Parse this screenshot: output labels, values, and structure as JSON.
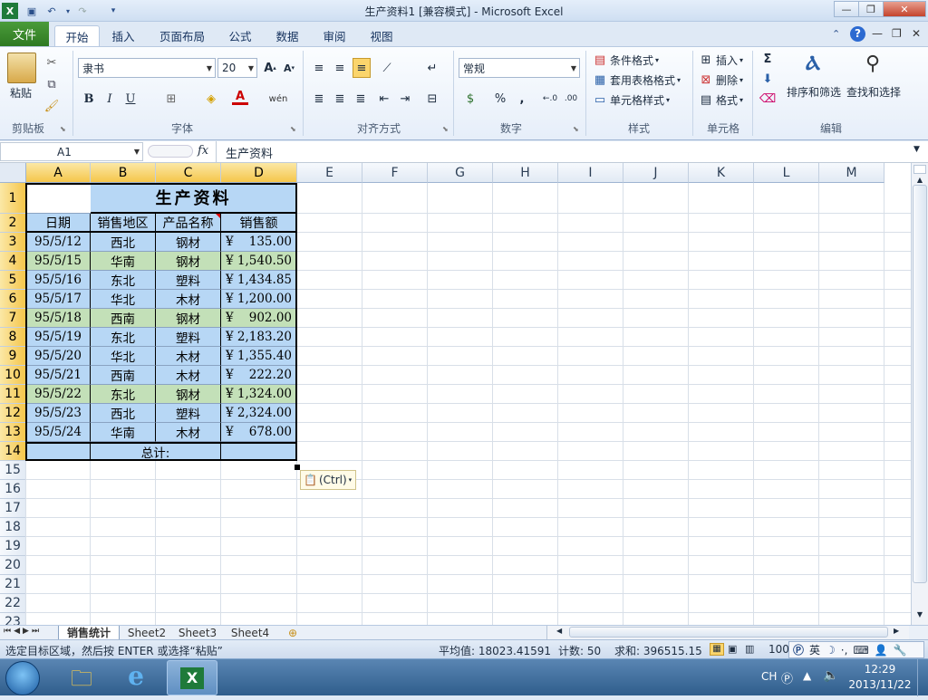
{
  "window": {
    "title": "生产资料1  [兼容模式]  -  Microsoft Excel"
  },
  "tabs": {
    "file": "文件",
    "items": [
      "开始",
      "插入",
      "页面布局",
      "公式",
      "数据",
      "审阅",
      "视图"
    ]
  },
  "ribbon": {
    "clipboard": {
      "paste": "粘贴",
      "label": "剪贴板"
    },
    "font": {
      "name": "隶书",
      "size": "20",
      "bold": "B",
      "italic": "I",
      "underline": "U",
      "label": "字体"
    },
    "alignment": {
      "label": "对齐方式"
    },
    "number": {
      "format": "常规",
      "percent": "%",
      "comma": ",",
      "label": "数字"
    },
    "styles": {
      "conditional": "条件格式",
      "table": "套用表格格式",
      "cell": "单元格样式",
      "label": "样式"
    },
    "cells": {
      "insert": "插入",
      "delete": "删除",
      "format": "格式",
      "label": "单元格"
    },
    "editing": {
      "sigma": "Σ",
      "sort": "排序和筛选",
      "find": "查找和选择",
      "label": "编辑"
    }
  },
  "formula_bar": {
    "name_box": "A1",
    "fx": "fx",
    "content": "生产资料"
  },
  "columns": [
    "A",
    "B",
    "C",
    "D",
    "E",
    "F",
    "G",
    "H",
    "I",
    "J",
    "K",
    "L",
    "M"
  ],
  "rows": [
    "1",
    "2",
    "3",
    "4",
    "5",
    "6",
    "7",
    "8",
    "9",
    "10",
    "11",
    "12",
    "13",
    "14",
    "15",
    "16",
    "17",
    "18",
    "19",
    "20",
    "21",
    "22",
    "23"
  ],
  "table": {
    "title": "生产资料",
    "headers": [
      "日期",
      "销售地区",
      "产品名称",
      "销售额"
    ],
    "rows": [
      {
        "date": "95/5/12",
        "region": "西北",
        "product": "钢材",
        "amount": "¥    135.00",
        "green": false
      },
      {
        "date": "95/5/15",
        "region": "华南",
        "product": "钢材",
        "amount": "¥ 1,540.50",
        "green": true
      },
      {
        "date": "95/5/16",
        "region": "东北",
        "product": "塑料",
        "amount": "¥ 1,434.85",
        "green": false
      },
      {
        "date": "95/5/17",
        "region": "华北",
        "product": "木材",
        "amount": "¥ 1,200.00",
        "green": false
      },
      {
        "date": "95/5/18",
        "region": "西南",
        "product": "钢材",
        "amount": "¥    902.00",
        "green": true
      },
      {
        "date": "95/5/19",
        "region": "东北",
        "product": "塑料",
        "amount": "¥ 2,183.20",
        "green": false
      },
      {
        "date": "95/5/20",
        "region": "华北",
        "product": "木材",
        "amount": "¥ 1,355.40",
        "green": false
      },
      {
        "date": "95/5/21",
        "region": "西南",
        "product": "木材",
        "amount": "¥    222.20",
        "green": false
      },
      {
        "date": "95/5/22",
        "region": "东北",
        "product": "钢材",
        "amount": "¥ 1,324.00",
        "green": true
      },
      {
        "date": "95/5/23",
        "region": "西北",
        "product": "塑料",
        "amount": "¥ 2,324.00",
        "green": false
      },
      {
        "date": "95/5/24",
        "region": "华南",
        "product": "木材",
        "amount": "¥    678.00",
        "green": false
      }
    ],
    "total_label": "总计:"
  },
  "paste_options": "(Ctrl)",
  "sheets": [
    "销售统计",
    "Sheet2",
    "Sheet3",
    "Sheet4"
  ],
  "status": {
    "message": "选定目标区域，然后按 ENTER 或选择“粘贴”",
    "average": "平均值: 18023.41591",
    "count": "计数: 50",
    "sum": "求和: 396515.15",
    "zoom": "100"
  },
  "ime": {
    "lang": "英"
  },
  "taskbar": {
    "lang": "CH",
    "time": "12:29",
    "date": "2013/11/22"
  },
  "colors": {
    "blue_fill": "#b7d7f5",
    "green_fill": "#c3e0b8",
    "file_tab": "#2e7a22"
  }
}
